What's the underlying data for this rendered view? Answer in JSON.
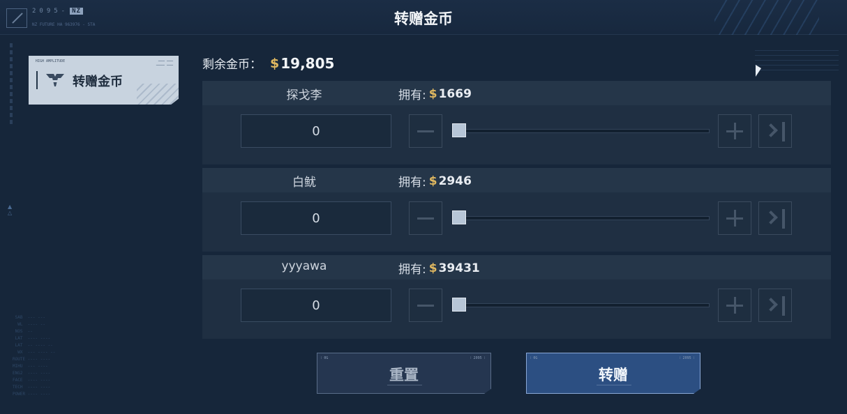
{
  "header": {
    "title": "转赠金币",
    "logo_text": "2095-",
    "logo_badge": "NZ",
    "logo_sub": "NZ FUTURE HA 963976 - STA"
  },
  "sidebar": {
    "card_top_left": "HIGH AMPLITUDE",
    "card_label": "转赠金币"
  },
  "balance": {
    "label": "剩余金币：",
    "currency_icon": "$",
    "value": "19,805"
  },
  "players": [
    {
      "name": "探戈李",
      "own_label": "拥有:",
      "amount": "1669",
      "input_value": "0",
      "slider_fraction": 0
    },
    {
      "name": "白鱿",
      "own_label": "拥有:",
      "amount": "2946",
      "input_value": "0",
      "slider_fraction": 0
    },
    {
      "name": "yyyawa",
      "own_label": "拥有:",
      "amount": "39431",
      "input_value": "0",
      "slider_fraction": 0
    }
  ],
  "buttons": {
    "reset_label": "重置",
    "give_label": "转赠",
    "corner_left": "⁞ 0G",
    "corner_right": "⁞ 2095 ⁞"
  },
  "colors": {
    "background": "#16263a",
    "coin": "#e0b860",
    "give_button": "#2c4f82",
    "reset_button": "#253650"
  }
}
